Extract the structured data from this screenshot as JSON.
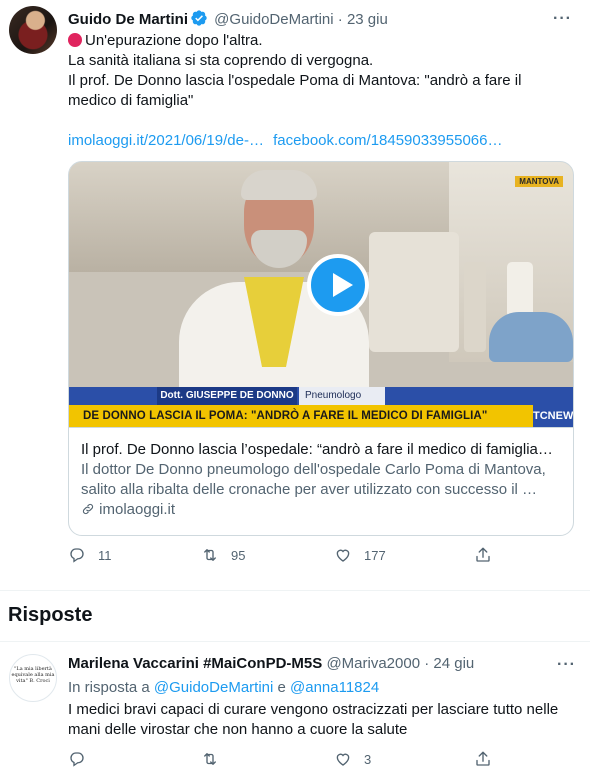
{
  "tweet": {
    "name": "Guido De Martini",
    "handle": "@GuidoDeMartini",
    "dot": "·",
    "date": "23 giu",
    "more": "···",
    "line1": "Un'epurazione dopo l'altra.",
    "line2": "La sanità italiana si sta coprendo di vergogna.",
    "line3": "Il prof. De Donno lascia l'ospedale Poma di Mantova: \"andrò a fare il medico di famiglia\"",
    "link1": "imolaoggi.it/2021/06/19/de-…",
    "link2": "facebook.com/18459033955066…",
    "card": {
      "caption_name": "Dott. GIUSEPPE DE DONNO",
      "caption_role": "Pneumologo",
      "headline_overlay": "DE DONNO LASCIA IL POMA: \"ANDRÒ A FARE IL MEDICO DI FAMIGLIA\"",
      "news_logo": "TCNEWS",
      "corner_tag": "MANTOVA",
      "title": "Il prof. De Donno lascia l’ospedale: “andrò a fare il medico di famiglia…",
      "description": "Il dottor De Donno pneumologo dell'ospedale Carlo Poma di Mantova, salito alla ribalta delle cronache per aver utilizzato con successo il …",
      "domain": "imolaoggi.it"
    },
    "stats": {
      "replies": "11",
      "retweets": "95",
      "likes": "177"
    }
  },
  "section_title": "Risposte",
  "reply": {
    "avatar_text": "\"La mia libertà equivale alla mia vita\" B. Croci",
    "name": "Marilena Vaccarini #MaiConPD-M5S",
    "handle": "@Mariva2000",
    "dot": "·",
    "date": "24 giu",
    "more": "···",
    "in_reply_prefix": "In risposta a",
    "in_reply_user1": "@GuidoDeMartini",
    "in_reply_and": "e",
    "in_reply_user2": "@anna11824",
    "body": "I medici bravi capaci di curare vengono ostracizzati per lasciare tutto nelle mani delle virostar che non hanno a cuore la salute",
    "stats": {
      "replies": "",
      "retweets": "",
      "likes": "3"
    }
  },
  "colors": {
    "accent": "#1d9bf0",
    "muted": "#536471",
    "stop_emoji": "#e0245e",
    "banner_yellow": "#f2c400",
    "banner_blue": "#2b4fa8"
  },
  "icons": [
    "verified-badge-icon",
    "stop-sign-icon",
    "reply-icon",
    "retweet-icon",
    "like-icon",
    "share-icon",
    "link-icon",
    "play-icon"
  ]
}
